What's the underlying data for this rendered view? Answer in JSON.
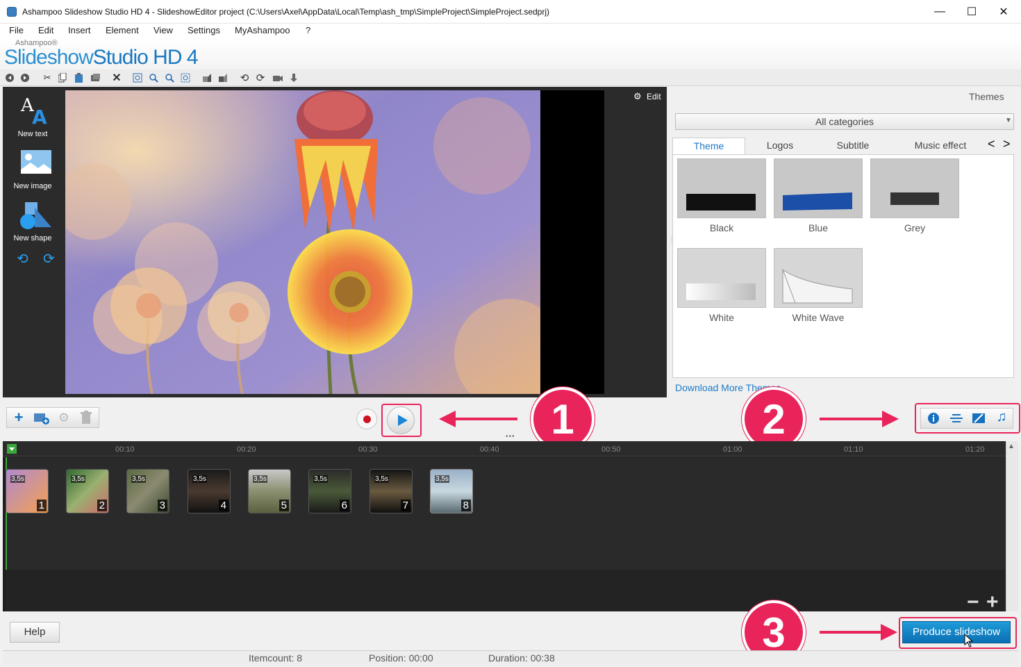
{
  "window": {
    "title": "Ashampoo Slideshow Studio HD 4 - SlideshowEditor project (C:\\Users\\Axel\\AppData\\Local\\Temp\\ash_tmp\\SimpleProject\\SimpleProject.sedprj)",
    "controls": [
      "—",
      "☐",
      "✕"
    ]
  },
  "menu": [
    "File",
    "Edit",
    "Insert",
    "Element",
    "View",
    "Settings",
    "MyAshampoo",
    "?"
  ],
  "brand": {
    "small": "Ashampoo®",
    "big_a": "Slideshow",
    "big_b": "Studio HD 4"
  },
  "toolbar": {
    "icons": [
      "back-icon",
      "forward-icon",
      "cut-icon",
      "copy-icon",
      "paste-icon",
      "screen-icon",
      "delete-icon",
      "zoom-fit-icon",
      "zoom-in-icon",
      "zoom-out-icon",
      "zoom-select-icon",
      "layer-up-icon",
      "layer-down-icon",
      "rotate-left-icon",
      "rotate-right-icon",
      "camera-icon",
      "record-icon"
    ]
  },
  "left_tools": {
    "new_text": "New text",
    "new_image": "New image",
    "new_shape": "New shape"
  },
  "preview": {
    "edit": "Edit"
  },
  "themes": {
    "title": "Themes",
    "category": "All categories",
    "tabs": [
      "Theme",
      "Logos",
      "Subtitle",
      "Music effect"
    ],
    "nav": [
      "<",
      ">"
    ],
    "items": [
      "Black",
      "Blue",
      "Grey",
      "White",
      "White Wave"
    ],
    "download": "Download More Themes..."
  },
  "annotations": [
    "1",
    "2",
    "3"
  ],
  "timeline": {
    "ticks": [
      "00:10",
      "00:20",
      "00:30",
      "00:40",
      "00:50",
      "01:00",
      "01:10",
      "01:20"
    ],
    "clips": [
      {
        "time": "3,5s",
        "num": "1"
      },
      {
        "time": "3,5s",
        "num": "2"
      },
      {
        "time": "3,5s",
        "num": "3"
      },
      {
        "time": "3,5s",
        "num": "4"
      },
      {
        "time": "3,5s",
        "num": "5"
      },
      {
        "time": "3,5s",
        "num": "6"
      },
      {
        "time": "3,5s",
        "num": "7"
      },
      {
        "time": "3,5s",
        "num": "8"
      }
    ],
    "zoom_out": "−",
    "zoom_in": "+"
  },
  "buttons": {
    "help": "Help",
    "produce": "Produce slideshow"
  },
  "status": {
    "itemcount": "Itemcount: 8",
    "position": "Position: 00:00",
    "duration": "Duration: 00:38"
  },
  "colors": {
    "accent": "#1e7bc8",
    "highlight": "#e8245a",
    "produce": "#0b6fb4"
  }
}
